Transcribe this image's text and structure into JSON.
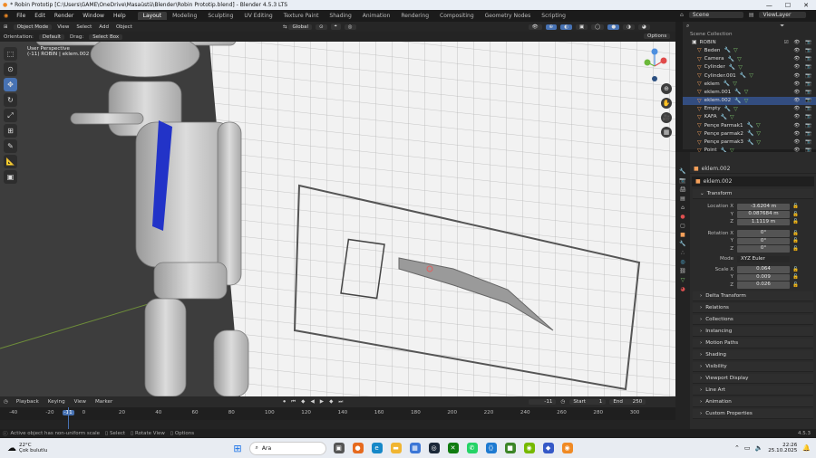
{
  "window": {
    "title": "* Robin Prototip [C:\\Users\\GAME\\OneDrive\\Masaüstü\\Blender\\Robin Prototip.blend] - Blender 4.5.3 LTS"
  },
  "menu": {
    "items": [
      "File",
      "Edit",
      "Render",
      "Window",
      "Help"
    ],
    "workspaces": [
      "Layout",
      "Modeling",
      "Sculpting",
      "UV Editing",
      "Texture Paint",
      "Shading",
      "Animation",
      "Rendering",
      "Compositing",
      "Geometry Nodes",
      "Scripting"
    ],
    "active_workspace": "Layout",
    "scene": "Scene",
    "view_layer": "ViewLayer"
  },
  "viewport_header": {
    "mode": "Object Mode",
    "view": "View",
    "select": "Select",
    "add": "Add",
    "object": "Object",
    "transform_orientation": "Global",
    "options": "Options"
  },
  "tool_settings": {
    "orientation_label": "Orientation:",
    "orientation": "Default",
    "drag_label": "Drag:",
    "drag": "Select Box"
  },
  "viewport": {
    "perspective": "User Perspective",
    "object_info": "(-11) ROBIN | eklem.002"
  },
  "outliner": {
    "collection": "Scene Collection",
    "root": "ROBIN",
    "items": [
      "Beden",
      "Camera",
      "Cylinder",
      "Cylinder.001",
      "eklem",
      "eklem.001",
      "eklem.002",
      "Empty",
      "KAFA",
      "Pençe Parmak1",
      "Pençe parmak2",
      "Pençe parmak3",
      "Point"
    ],
    "search_placeholder": ""
  },
  "properties": {
    "object_header": "eklem.002",
    "object_name": "eklem.002",
    "transform": "Transform",
    "location_label": "Location X",
    "loc": [
      "-3.6204 m",
      "0.087684 m",
      "1.1119 m"
    ],
    "rotation_label": "Rotation X",
    "rot": [
      "0°",
      "0°",
      "0°"
    ],
    "mode_label": "Mode",
    "mode": "XYZ Euler",
    "scale_label": "Scale X",
    "scale": [
      "0.064",
      "0.009",
      "0.026"
    ],
    "y": "Y",
    "z": "Z",
    "sections": [
      "Delta Transform",
      "Relations",
      "Collections",
      "Instancing",
      "Motion Paths",
      "Shading",
      "Visibility",
      "Viewport Display",
      "Line Art",
      "Animation",
      "Custom Properties"
    ]
  },
  "timeline": {
    "playback": "Playback",
    "keying": "Keying",
    "view": "View",
    "marker": "Marker",
    "current_frame": "-11",
    "start_label": "Start",
    "start": "1",
    "end_label": "End",
    "end": "250",
    "ticks": [
      "-40",
      "-20",
      "-11",
      "0",
      "20",
      "40",
      "60",
      "80",
      "100",
      "120",
      "140",
      "160",
      "180",
      "200",
      "220",
      "240",
      "260",
      "280",
      "300"
    ]
  },
  "status": {
    "msg1": "Active object has non-uniform scale",
    "select": "Select",
    "rotate_view": "Rotate View",
    "options": "Options",
    "version": "4.5.3"
  },
  "taskbar": {
    "weather_temp": "22°C",
    "weather_desc": "Çok bulutlu",
    "search": "Ara",
    "time": "22:26",
    "date": "25.10.2025"
  }
}
